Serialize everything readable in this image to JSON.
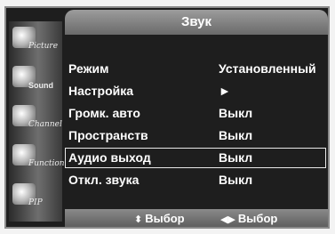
{
  "menu": {
    "title": "Звук"
  },
  "sidebar": {
    "items": [
      {
        "label": "Picture",
        "icon": "picture-icon"
      },
      {
        "label": "Sound",
        "icon": "sound-icon"
      },
      {
        "label": "Channel",
        "icon": "channel-icon"
      },
      {
        "label": "Function",
        "icon": "function-icon"
      },
      {
        "label": "PIP",
        "icon": "pip-icon"
      }
    ]
  },
  "settings": [
    {
      "label": "Режим",
      "value": "Установленный"
    },
    {
      "label": "Настройка",
      "value": "►"
    },
    {
      "label": "Громк. авто",
      "value": "Выкл"
    },
    {
      "label": "Пространств",
      "value": "Выкл"
    },
    {
      "label": "Аудио выход",
      "value": "Выкл"
    },
    {
      "label": "Откл. звука",
      "value": "Выкл"
    }
  ],
  "footer": {
    "updown_glyph": "⬍",
    "updown_label": "Выбор",
    "leftright_glyph": "◀▶",
    "leftright_label": "Выбор"
  },
  "colors": {
    "background": "#1e1e1e",
    "text": "#ffffff",
    "bar": "#8a8a8a",
    "highlight_border": "#e8e8e8"
  }
}
